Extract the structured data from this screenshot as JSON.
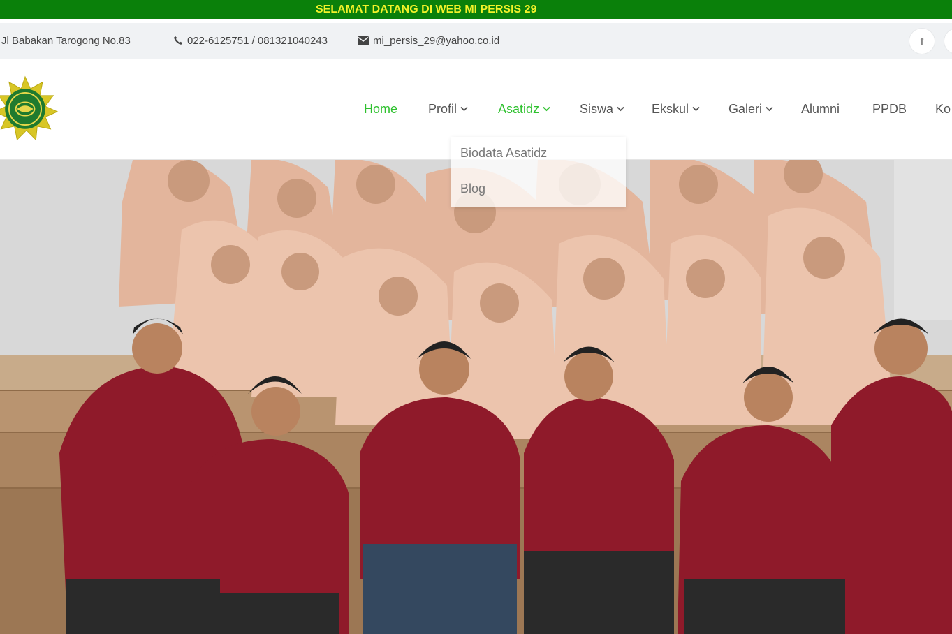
{
  "topbar": {
    "message": "SELAMAT DATANG DI WEB MI PERSIS 29"
  },
  "contact": {
    "address": "Jl Babakan Tarogong No.83",
    "phone": "022-6125751 / 081321040243",
    "email": "mi_persis_29@yahoo.co.id",
    "social_facebook_glyph": "f"
  },
  "nav": {
    "home": "Home",
    "profil": "Profil",
    "asatidz": "Asatidz",
    "siswa": "Siswa",
    "ekskul": "Ekskul",
    "galeri": "Galeri",
    "alumni": "Alumni",
    "ppdb": "PPDB",
    "kontak": "Ko"
  },
  "dropdown": {
    "items": [
      "Biodata Asatidz",
      "Blog"
    ]
  },
  "colors": {
    "topbar_bg": "#0a800a",
    "topbar_text": "#f2f22a",
    "nav_active": "#2fc12f",
    "uniform": "#8f1a2a",
    "hijab": "#e6b8a2"
  },
  "icons": {
    "phone": "phone-icon",
    "email": "envelope-icon",
    "facebook": "facebook-icon",
    "chevron": "chevron-down-icon"
  }
}
